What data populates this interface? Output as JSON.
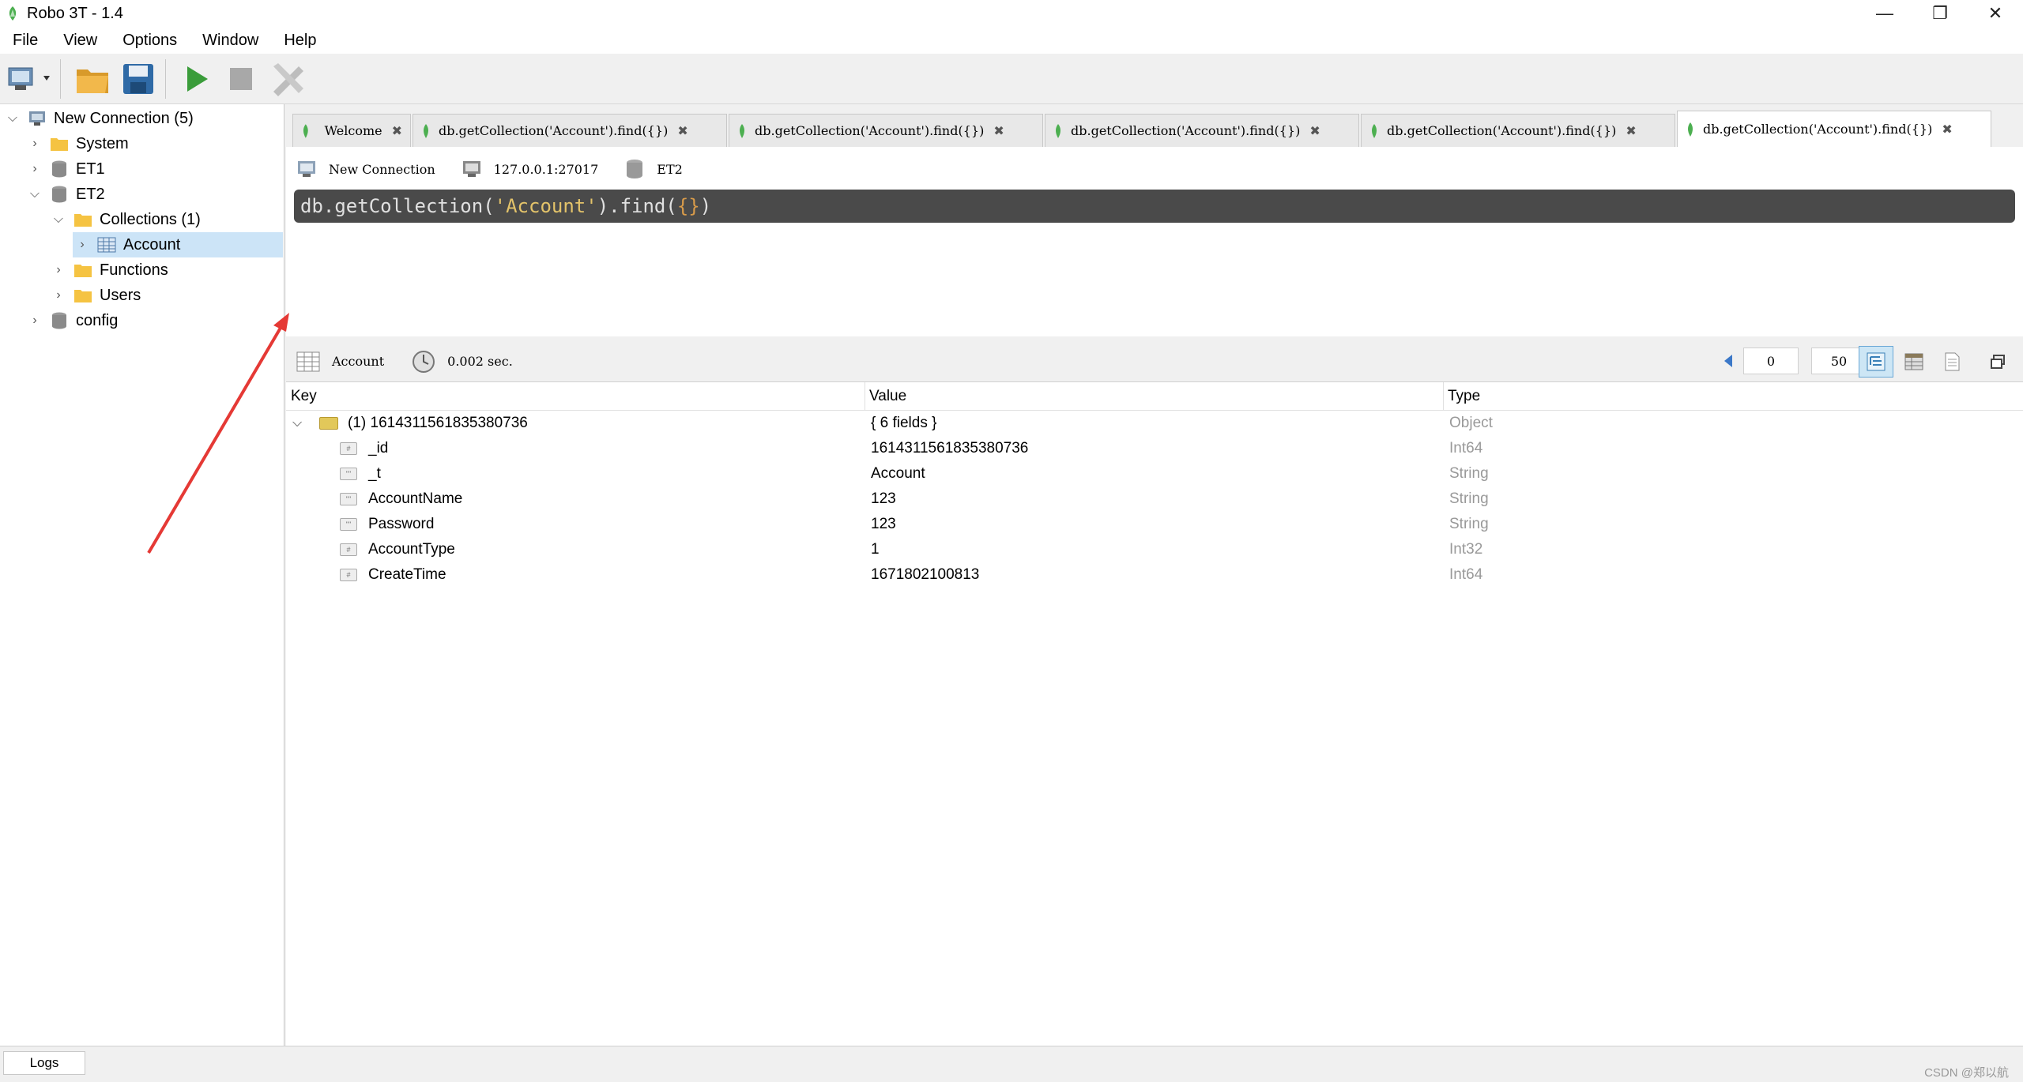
{
  "window": {
    "title": "Robo 3T - 1.4",
    "minimize": "—",
    "restore": "❐",
    "close": "✕"
  },
  "menu": [
    "File",
    "View",
    "Options",
    "Window",
    "Help"
  ],
  "toolbar": {
    "connect_icon": "connect-icon",
    "open_icon": "folder-open-icon",
    "save_icon": "save-icon",
    "run_icon": "run-icon",
    "stop_icon": "stop-icon",
    "tools_icon": "tools-icon"
  },
  "tree": {
    "connection": "New Connection (5)",
    "dbs": [
      "System",
      "ET1",
      "ET2",
      "config"
    ],
    "collections_folder": "Collections (1)",
    "collection": "Account",
    "functions": "Functions",
    "users": "Users"
  },
  "tabs": [
    {
      "label": "Welcome",
      "active": false
    },
    {
      "label": "db.getCollection('Account').find({})",
      "active": false
    },
    {
      "label": "db.getCollection('Account').find({})",
      "active": false
    },
    {
      "label": "db.getCollection('Account').find({})",
      "active": false
    },
    {
      "label": "db.getCollection('Account').find({})",
      "active": false
    },
    {
      "label": "db.getCollection('Account').find({})",
      "active": true
    }
  ],
  "tab_close": "✖",
  "query": {
    "connection": "New Connection",
    "host": "127.0.0.1:27017",
    "database": "ET2",
    "editor_prefix": "db.getCollection(",
    "editor_string": "'Account'",
    "editor_mid": ").find(",
    "editor_braces": "{}",
    "editor_suffix": ")"
  },
  "results": {
    "collection": "Account",
    "time": "0.002 sec.",
    "skip": "0",
    "limit": "50"
  },
  "grid": {
    "headers": {
      "key": "Key",
      "value": "Value",
      "type": "Type"
    },
    "document": {
      "key": "(1) 1614311561835380736",
      "value": "{ 6 fields }",
      "type": "Object"
    },
    "fields": [
      {
        "key": "_id",
        "value": "1614311561835380736",
        "type": "Int64"
      },
      {
        "key": "_t",
        "value": "Account",
        "type": "String"
      },
      {
        "key": "AccountName",
        "value": "123",
        "type": "String"
      },
      {
        "key": "Password",
        "value": "123",
        "type": "String"
      },
      {
        "key": "AccountType",
        "value": "1",
        "type": "Int32"
      },
      {
        "key": "CreateTime",
        "value": "1671802100813",
        "type": "Int64"
      }
    ]
  },
  "status": {
    "logs": "Logs",
    "watermark": "CSDN @郑以航"
  },
  "colors": {
    "accent": "#cce4f7",
    "editor_bg": "#4a4a4a",
    "arrow": "#e53935"
  }
}
